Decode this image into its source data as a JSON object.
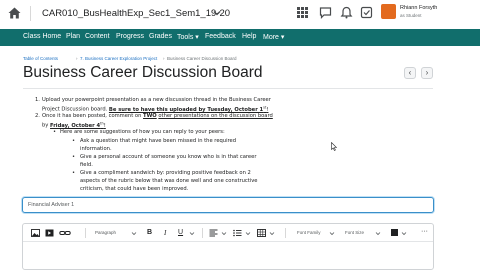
{
  "course": {
    "title": "CAR010_BusHealthExp_Sec1_Sem1_19-20"
  },
  "user": {
    "name": "Rhiann Forsyth",
    "role": "as Student"
  },
  "nav": {
    "items": [
      "Class Home",
      "Plan",
      "Content",
      "Progress",
      "Grades",
      "Tools ▾",
      "Feedback",
      "Help",
      "More ▾"
    ]
  },
  "breadcrumb": {
    "items": [
      "Table of Contents",
      "7. Business Career Exploration Project",
      "Business Career Discussion Board"
    ]
  },
  "page": {
    "title": "Business Career Discussion Board",
    "prev": "‹",
    "next": "›"
  },
  "instructions": {
    "i1_num": "1.",
    "i1_a": "Upload your powerpoint presentation as a new discussion thread in the Business Career",
    "i1_b_pre": "Project Discussion board.",
    "i1_b_due": "Be sure to have this uploaded by Tuesday, October 1",
    "i1_b_sup": "st",
    "i1_b_end": "!",
    "i2_num": "2.",
    "i2_a_pre": "Once it has been posted, comment on",
    "i2_a_two": "TWO",
    "i2_a_post": "other presentations on the discussion board",
    "i2_b_pre": "by",
    "i2_b_day": "Friday, October 4",
    "i2_b_sup": "th",
    "i2_b_end": "!",
    "i2_c": "Here are some suggestions of how you can reply to your peers:",
    "s1_a": "Ask a question that might have been missed in the required",
    "s1_b": "information.",
    "s2_a": "Give a personal account of someone you know who is in that career",
    "s2_b": "field.",
    "s3_a": "Give a compliment sandwich by: providing positive feedback on 2",
    "s3_b": "aspects of the rubric below that was done well and one constructive",
    "s3_c": "criticism, that could have been improved."
  },
  "subject": {
    "value": "Financial Adviser 1"
  },
  "toolbar": {
    "paragraph": "Paragraph",
    "bold": "B",
    "italic": "I",
    "underline": "U",
    "font_family": "Font Family",
    "font_size": "Font Size",
    "more": "···"
  }
}
